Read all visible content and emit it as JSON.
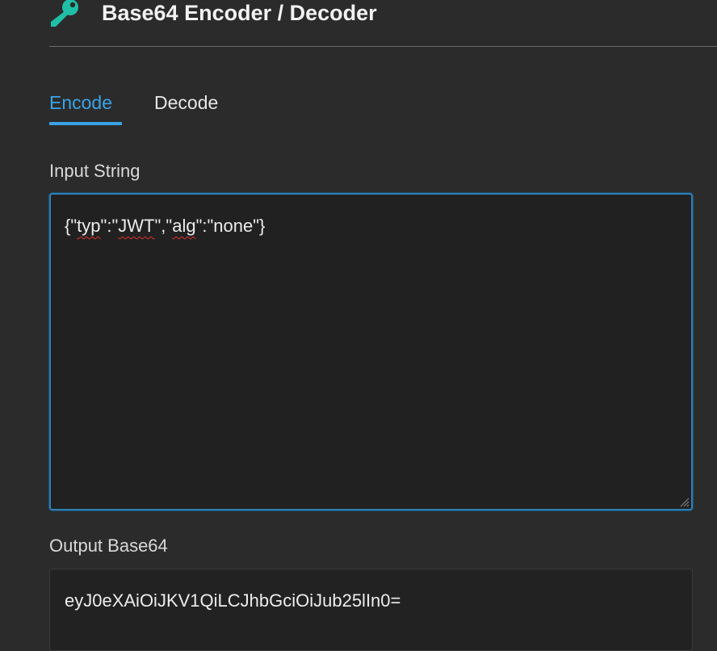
{
  "header": {
    "title": "Base64 Encoder / Decoder",
    "icon": "key-icon",
    "icon_color": "#1fbfa6"
  },
  "tabs": [
    {
      "label": "Encode",
      "active": true
    },
    {
      "label": "Decode",
      "active": false
    }
  ],
  "accent_color": "#3aa3e6",
  "input": {
    "label": "Input String",
    "segments": [
      "{\"",
      "typ",
      "\":\"",
      "JWT",
      "\",\"",
      "alg",
      "\":\"none\"}"
    ]
  },
  "output": {
    "label": "Output Base64",
    "value": "eyJ0eXAiOiJKV1QiLCJhbGciOiJub25lIn0="
  }
}
